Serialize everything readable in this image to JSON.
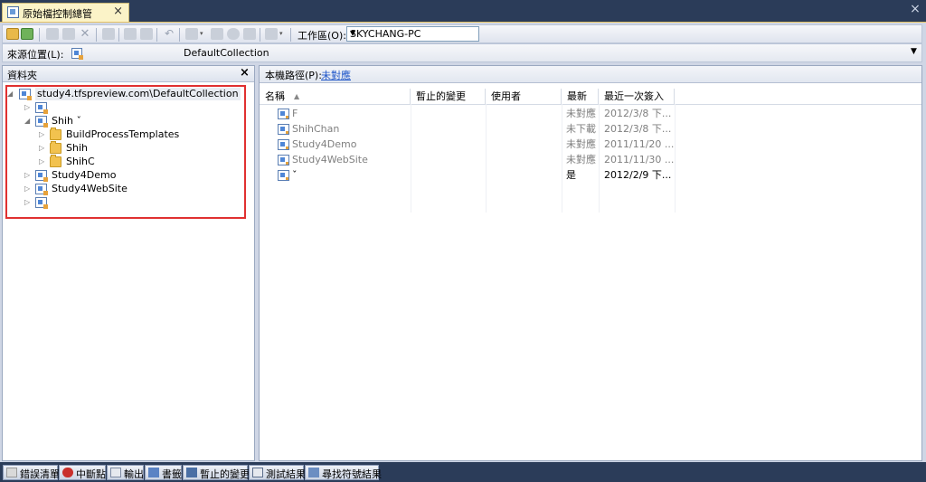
{
  "tab": {
    "title": "原始檔控制總管",
    "close": "×"
  },
  "window_close": "×",
  "toolbar": {
    "workspace_label": "工作區(O):",
    "workspace_value": "SKYCHANG-PC"
  },
  "source": {
    "label": "來源位置(L):",
    "value": "DefaultCollection"
  },
  "folders": {
    "title": "資料夾",
    "close": "×",
    "tree": [
      {
        "label": "study4.tfspreview.com\\DefaultCollection",
        "icon": "project-collection-icon"
      },
      {
        "label": "",
        "icon": "team-project-icon"
      },
      {
        "label": "Shih ˇ",
        "icon": "team-project-icon"
      },
      {
        "label": "BuildProcessTemplates",
        "icon": "folder-icon"
      },
      {
        "label": "Shih",
        "icon": "folder-icon"
      },
      {
        "label": "ShihC",
        "icon": "folder-icon"
      },
      {
        "label": "Study4Demo",
        "icon": "team-project-icon"
      },
      {
        "label": "Study4WebSite",
        "icon": "team-project-icon"
      },
      {
        "label": "",
        "icon": "team-project-icon"
      }
    ]
  },
  "local_path": {
    "label": "本機路徑(P):",
    "value": "未對應"
  },
  "columns": {
    "name": "名稱",
    "pending": "暫止的變更",
    "user": "使用者",
    "latest": "最新",
    "checkin": "最近一次簽入"
  },
  "rows": [
    {
      "name": "F",
      "latest": "未對應",
      "checkin": "2012/3/8 下..."
    },
    {
      "name": "ShihChan",
      "latest": "未下載",
      "checkin": "2012/3/8 下..."
    },
    {
      "name": "Study4Demo",
      "latest": "未對應",
      "checkin": "2011/11/20 ..."
    },
    {
      "name": "Study4WebSite",
      "latest": "未對應",
      "checkin": "2011/11/30 ..."
    },
    {
      "name": "ˇ",
      "latest": "是",
      "checkin": "2012/2/9 下..."
    }
  ],
  "bottom_tabs": [
    {
      "label": "錯誤清單",
      "icon": "error-list-icon"
    },
    {
      "label": "中斷點",
      "icon": "breakpoint-icon"
    },
    {
      "label": "輸出",
      "icon": "output-icon"
    },
    {
      "label": "書籤",
      "icon": "bookmark-icon"
    },
    {
      "label": "暫止的變更",
      "icon": "pending-changes-icon"
    },
    {
      "label": "測試結果",
      "icon": "test-results-icon"
    },
    {
      "label": "尋找符號結果",
      "icon": "find-symbol-icon"
    }
  ]
}
